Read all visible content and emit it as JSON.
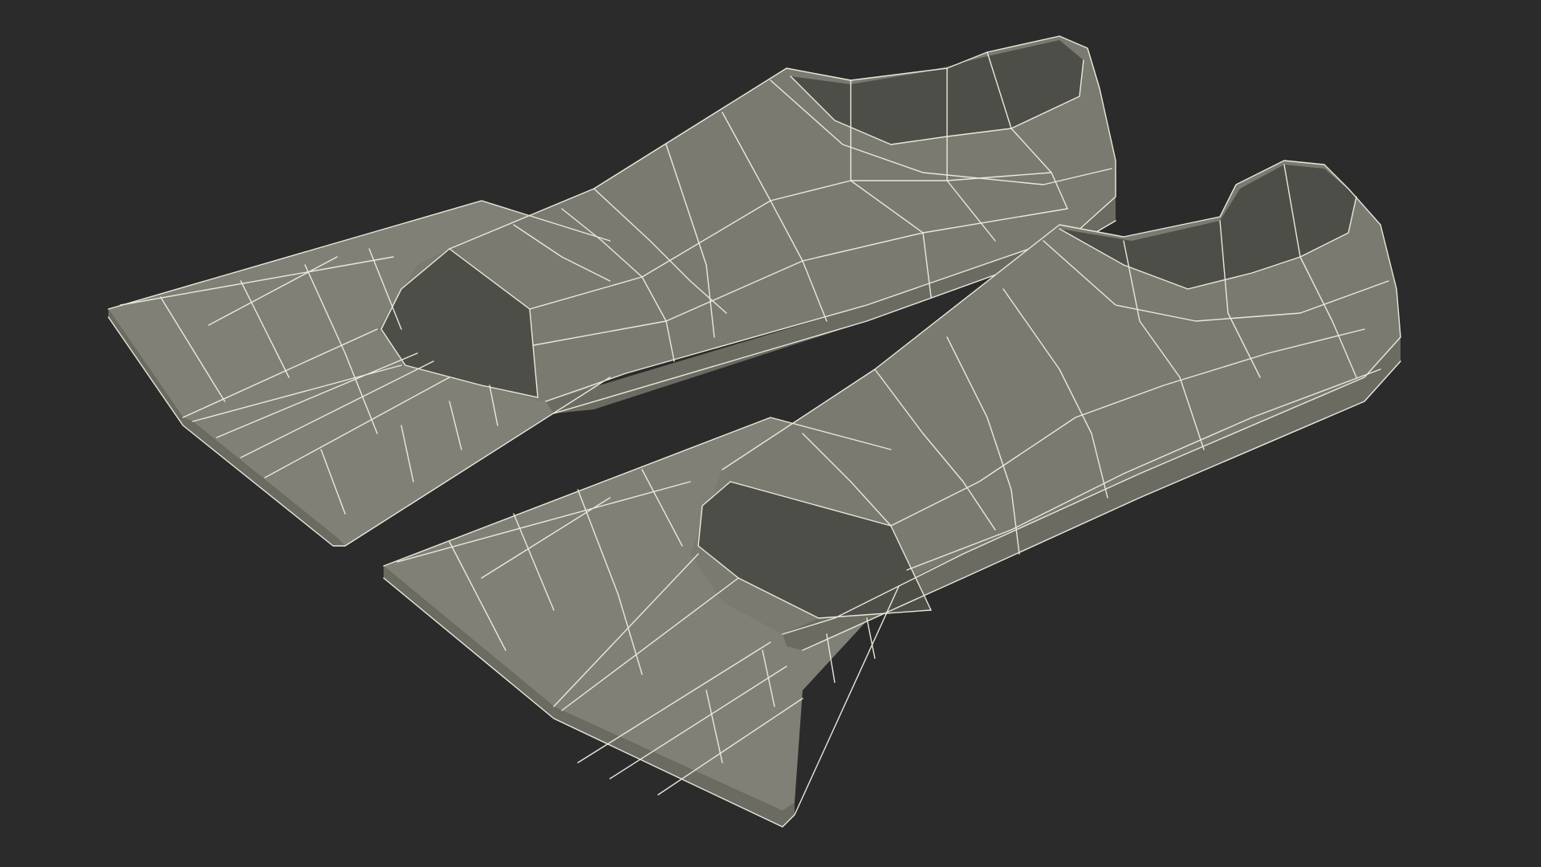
{
  "scene": {
    "subject": "",
    "colors": {
      "background": "#2b2b2b",
      "mesh_surface": "#7a7a70",
      "wireframe": "#e8e8dc"
    },
    "objects": [
      {
        "id": "fin-left",
        "icon": "swim-fin-wireframe"
      },
      {
        "id": "fin-right",
        "icon": "swim-fin-wireframe"
      }
    ]
  }
}
